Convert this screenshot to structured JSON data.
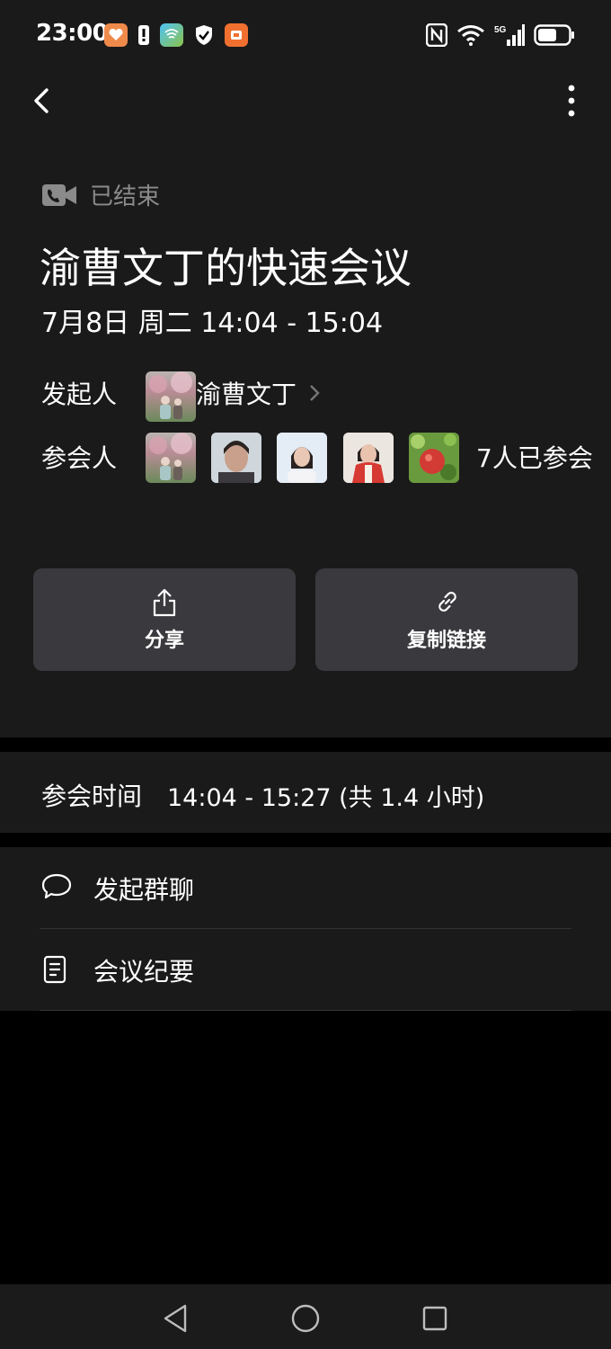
{
  "status_bar": {
    "time": "23:00"
  },
  "meeting": {
    "state": "已结束",
    "title": "渝曹文丁的快速会议",
    "datetime": "7月8日 周二 14:04 - 15:04"
  },
  "organizer": {
    "label": "发起人",
    "name": "渝曹文丁"
  },
  "participants": {
    "label": "参会人",
    "count_text": "7人已参会"
  },
  "actions": {
    "share": "分享",
    "copy_link": "复制链接"
  },
  "attendance": {
    "label": "参会时间",
    "value": "14:04 - 15:27 (共 1.4 小时)"
  },
  "menu": [
    {
      "label": "发起群聊",
      "icon": "chat-bubble-icon"
    },
    {
      "label": "会议纪要",
      "icon": "document-icon"
    }
  ],
  "colors": {
    "background": "#1a1a1a",
    "button": "#3a3a3e",
    "muted": "#8b8b8b"
  }
}
